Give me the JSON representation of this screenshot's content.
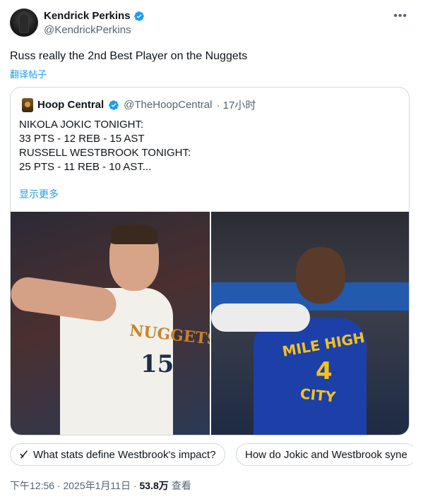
{
  "author": {
    "name": "Kendrick Perkins",
    "handle": "@KendrickPerkins",
    "verified": true
  },
  "more_icon": "more-horizontal-icon",
  "tweet": {
    "text": "Russ really the 2nd Best Player on the Nuggets",
    "translate_label": "翻译帖子"
  },
  "quote": {
    "name": "Hoop Central",
    "handle": "@TheHoopCentral",
    "time": "· 17小时",
    "lines": [
      "NIKOLA JOKIC TONIGHT:",
      "33 PTS - 12 REB - 15 AST",
      "",
      "RUSSELL WESTBROOK TONIGHT:",
      "25 PTS - 11 REB - 10 AST..."
    ],
    "show_more": "显示更多",
    "images": {
      "left": {
        "jersey_word": "NUGGETS",
        "jersey_number": "15"
      },
      "right": {
        "jersey_line1": "MILE HIGH",
        "jersey_number": "4",
        "jersey_line2": "CITY"
      }
    }
  },
  "chips": [
    "What stats define Westbrook's impact?",
    "How do Jokic and Westbrook syne"
  ],
  "meta": {
    "time": "下午12:56 · 2025年1月11日 ·",
    "views": "53.8万",
    "views_label": "查看"
  },
  "colors": {
    "accent": "#1d9bf0",
    "secondary": "#536471",
    "border": "#cfd9de"
  }
}
